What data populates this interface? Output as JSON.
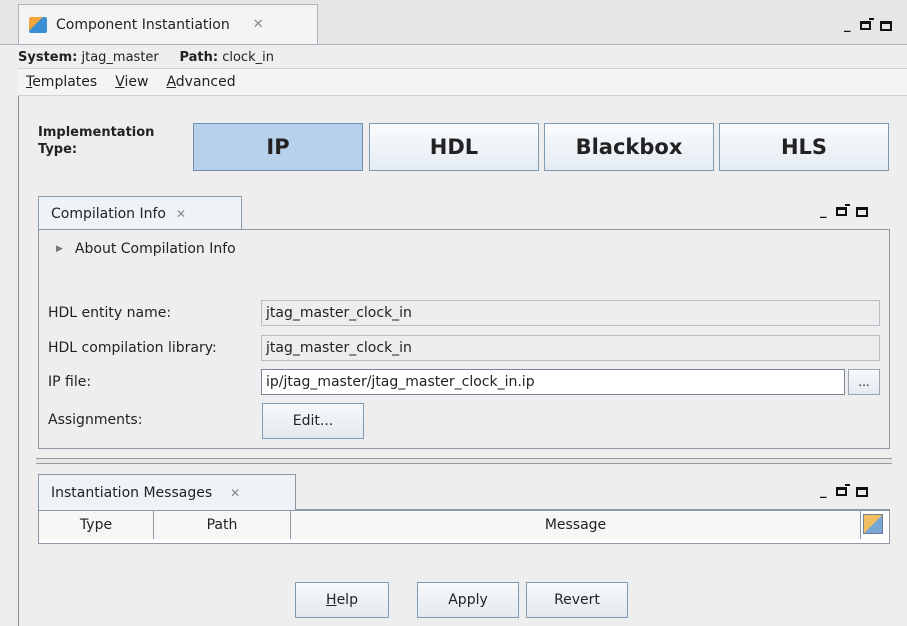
{
  "window": {
    "tab_title": "Component Instantiation",
    "tab_close": "✕",
    "min": "_",
    "restore_icon": "restore-icon",
    "maximize_icon": "maximize-icon"
  },
  "system_line": {
    "system_label": "System:",
    "system_value": "jtag_master",
    "path_label": "Path:",
    "path_value": "clock_in"
  },
  "menu": {
    "items": [
      {
        "label": "Templates",
        "mnemonic": "T"
      },
      {
        "label": "View",
        "mnemonic": "V"
      },
      {
        "label": "Advanced",
        "mnemonic": "A"
      }
    ]
  },
  "implementation": {
    "label_line1": "Implementation",
    "label_line2": "Type:",
    "options": [
      "IP",
      "HDL",
      "Blackbox",
      "HLS"
    ],
    "selected": "IP"
  },
  "compilation_info": {
    "tab_title": "Compilation Info",
    "tab_close": "✕",
    "about_label": "About Compilation Info",
    "fields": {
      "hdl_entity_label": "HDL entity name:",
      "hdl_entity_value": "jtag_master_clock_in",
      "hdl_library_label": "HDL compilation library:",
      "hdl_library_value": "jtag_master_clock_in",
      "ip_file_label": "IP file:",
      "ip_file_value": "ip/jtag_master/jtag_master_clock_in.ip",
      "browse_label": "...",
      "assignments_label": "Assignments:",
      "edit_button": "Edit..."
    }
  },
  "messages": {
    "tab_title": "Instantiation Messages",
    "tab_close": "✕",
    "columns": [
      "Type",
      "Path",
      "Message"
    ]
  },
  "footer": {
    "help": "Help",
    "apply": "Apply",
    "revert": "Revert"
  },
  "colors": {
    "accent_selected": "#b8d1ea",
    "border": "#8f99a5"
  }
}
